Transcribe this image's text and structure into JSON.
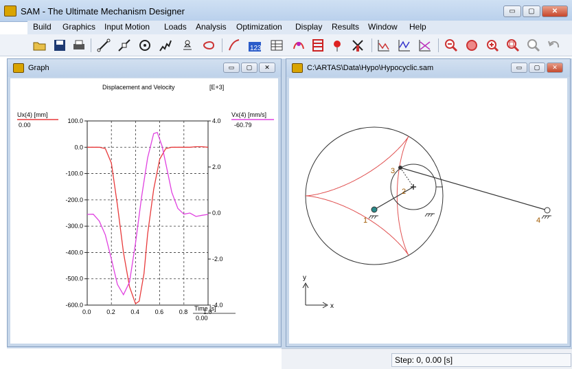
{
  "app": {
    "title": "SAM - The Ultimate Mechanism Designer"
  },
  "window_buttons": {
    "minimize": "▭",
    "maximize": "▢",
    "close": "✕"
  },
  "menu": [
    "Build",
    "Graphics",
    "Input Motion",
    "Loads",
    "Analysis",
    "Optimization",
    "Display",
    "Results",
    "Window",
    "Help"
  ],
  "toolbar": {
    "icons": [
      "open-icon",
      "save-icon",
      "print-icon",
      "link-icon",
      "slider-icon",
      "gear-element-icon",
      "spring-icon",
      "support-icon",
      "belt-icon",
      "input-motion-icon",
      "numbering-icon",
      "table-icon",
      "animation-icon",
      "frame-icon",
      "balloon-icon",
      "windmill-icon",
      "graph-icon",
      "graph2-icon",
      "graph3-icon",
      "zoom-out-icon",
      "zoom-dynamic-icon",
      "zoom-in-icon",
      "zoom-window-icon",
      "pan-icon",
      "undo-icon"
    ]
  },
  "graph_window": {
    "title": "Graph",
    "left_label": "Ux(4) [mm]",
    "left_value": "0.00",
    "right_label": "Vx(4) [mm/s]",
    "right_value": "-60.79",
    "time_label": "Time [s]",
    "time_value": "0.00"
  },
  "chart_data": {
    "type": "line",
    "title": "Displacement and Velocity",
    "scale_note": "[E+3]",
    "xlabel": "Time [s]",
    "xlim": [
      0.0,
      1.0
    ],
    "x_ticks": [
      "0.0",
      "0.2",
      "0.4",
      "0.6",
      "0.8",
      "1.0"
    ],
    "y_left_lim": [
      -600,
      100
    ],
    "y_left_ticks": [
      "100.0",
      "0.0",
      "-100.0",
      "-200.0",
      "-300.0",
      "-400.0",
      "-500.0",
      "-600.0"
    ],
    "y_right_lim": [
      -4.0,
      4.0
    ],
    "y_right_ticks": [
      "4.0",
      "2.0",
      "0.0",
      "-2.0",
      "-4.0"
    ],
    "grid": true,
    "series": [
      {
        "name": "Ux(4) [mm]",
        "axis": "left",
        "color": "#e8393a",
        "x": [
          0.0,
          0.1,
          0.15,
          0.2,
          0.25,
          0.3,
          0.35,
          0.4,
          0.43,
          0.47,
          0.5,
          0.55,
          0.6,
          0.65,
          0.7,
          0.75,
          0.8,
          0.85,
          0.9,
          0.95,
          1.0
        ],
        "y": [
          0,
          0,
          -5,
          -60,
          -220,
          -400,
          -530,
          -595,
          -585,
          -480,
          -330,
          -160,
          -45,
          -5,
          0,
          0,
          0,
          0,
          2,
          2,
          0
        ]
      },
      {
        "name": "Vx(4) [mm/s]",
        "axis": "right",
        "color": "#e040e0",
        "x": [
          0.0,
          0.05,
          0.1,
          0.15,
          0.2,
          0.25,
          0.3,
          0.35,
          0.4,
          0.45,
          0.5,
          0.55,
          0.58,
          0.62,
          0.66,
          0.7,
          0.75,
          0.8,
          0.85,
          0.9,
          0.95,
          1.0
        ],
        "y": [
          -0.06,
          -0.05,
          -0.35,
          -0.95,
          -2.0,
          -3.1,
          -3.55,
          -3.0,
          -1.3,
          0.7,
          2.4,
          3.45,
          3.5,
          2.9,
          1.9,
          0.9,
          0.2,
          -0.05,
          0.0,
          -0.15,
          -0.1,
          -0.06
        ]
      }
    ]
  },
  "mechanism_window": {
    "title": "C:\\ARTAS\\Data\\Hypo\\Hypocyclic.sam",
    "node_labels": [
      "1",
      "2",
      "3",
      "4"
    ],
    "axis_y": "y",
    "axis_x": "x"
  },
  "status": {
    "step": "Step: 0,     0.00 [s]"
  },
  "colors": {
    "curve_red": "#e8393a",
    "curve_magenta": "#e040e0",
    "hypocycloid": "#e05050"
  }
}
